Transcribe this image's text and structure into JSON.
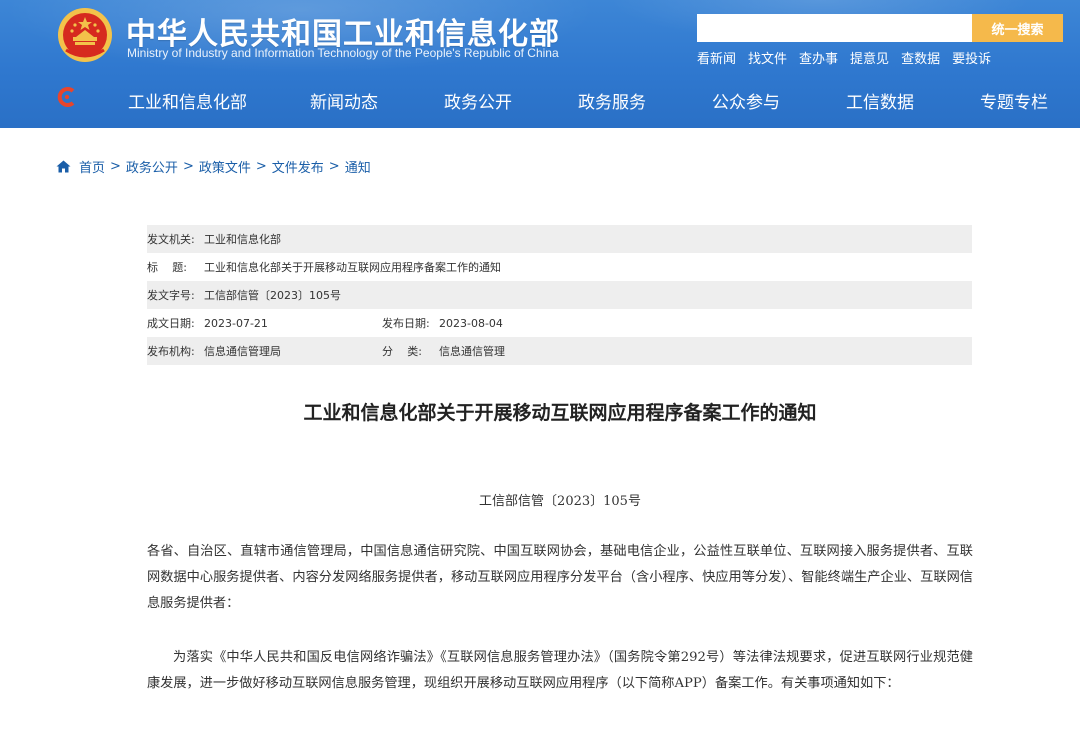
{
  "header": {
    "title": "中华人民共和国工业和信息化部",
    "subtitle": "Ministry of Industry and Information Technology of the People's Republic of China",
    "search": {
      "placeholder": "",
      "button_label": "统一搜索"
    },
    "quick_links": [
      "看新闻",
      "找文件",
      "查办事",
      "提意见",
      "查数据",
      "要投诉"
    ],
    "nav": [
      "工业和信息化部",
      "新闻动态",
      "政务公开",
      "政务服务",
      "公众参与",
      "工信数据",
      "专题专栏"
    ]
  },
  "breadcrumb": [
    "首页",
    "政务公开",
    "政策文件",
    "文件发布",
    "通知"
  ],
  "metadata": {
    "issuer_label": "发文机关:",
    "issuer": "工业和信息化部",
    "title_label_a": "标",
    "title_label_b": "题:",
    "title": "工业和信息化部关于开展移动互联网应用程序备案工作的通知",
    "doc_no_label": "发文字号:",
    "doc_no": "工信部信管〔2023〕105号",
    "written_date_label": "成文日期:",
    "written_date": "2023-07-21",
    "publish_date_label": "发布日期:",
    "publish_date": "2023-08-04",
    "publisher_label": "发布机构:",
    "publisher": "信息通信管理局",
    "category_label_a": "分",
    "category_label_b": "类:",
    "category": "信息通信管理"
  },
  "article": {
    "title": "工业和信息化部关于开展移动互联网应用程序备案工作的通知",
    "doc_number": "工信部信管〔2023〕105号",
    "paragraphs": [
      "各省、自治区、直辖市通信管理局，中国信息通信研究院、中国互联网协会，基础电信企业，公益性互联单位、互联网接入服务提供者、互联网数据中心服务提供者、内容分发网络服务提供者，移动互联网应用程序分发平台（含小程序、快应用等分发）、智能终端生产企业、互联网信息服务提供者：",
      "为落实《中华人民共和国反电信网络诈骗法》《互联网信息服务管理办法》（国务院令第292号）等法律法规要求，促进互联网行业规范健康发展，进一步做好移动互联网信息服务管理，现组织开展移动互联网应用程序（以下简称APP）备案工作。有关事项通知如下："
    ]
  },
  "colors": {
    "header_blue": "#2f78cf",
    "search_button": "#f5b94b",
    "breadcrumb_link": "#1a5ea8",
    "table_shade": "#eeeeee"
  }
}
